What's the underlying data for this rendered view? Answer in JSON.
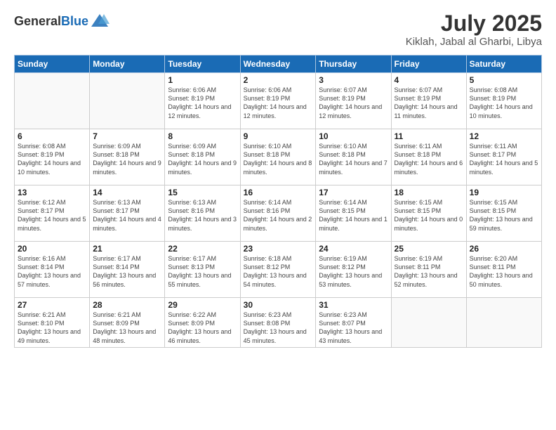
{
  "logo": {
    "general": "General",
    "blue": "Blue"
  },
  "header": {
    "month": "July 2025",
    "location": "Kiklah, Jabal al Gharbi, Libya"
  },
  "weekdays": [
    "Sunday",
    "Monday",
    "Tuesday",
    "Wednesday",
    "Thursday",
    "Friday",
    "Saturday"
  ],
  "weeks": [
    [
      {
        "day": "",
        "info": ""
      },
      {
        "day": "",
        "info": ""
      },
      {
        "day": "1",
        "info": "Sunrise: 6:06 AM\nSunset: 8:19 PM\nDaylight: 14 hours and 12 minutes."
      },
      {
        "day": "2",
        "info": "Sunrise: 6:06 AM\nSunset: 8:19 PM\nDaylight: 14 hours and 12 minutes."
      },
      {
        "day": "3",
        "info": "Sunrise: 6:07 AM\nSunset: 8:19 PM\nDaylight: 14 hours and 12 minutes."
      },
      {
        "day": "4",
        "info": "Sunrise: 6:07 AM\nSunset: 8:19 PM\nDaylight: 14 hours and 11 minutes."
      },
      {
        "day": "5",
        "info": "Sunrise: 6:08 AM\nSunset: 8:19 PM\nDaylight: 14 hours and 10 minutes."
      }
    ],
    [
      {
        "day": "6",
        "info": "Sunrise: 6:08 AM\nSunset: 8:19 PM\nDaylight: 14 hours and 10 minutes."
      },
      {
        "day": "7",
        "info": "Sunrise: 6:09 AM\nSunset: 8:18 PM\nDaylight: 14 hours and 9 minutes."
      },
      {
        "day": "8",
        "info": "Sunrise: 6:09 AM\nSunset: 8:18 PM\nDaylight: 14 hours and 9 minutes."
      },
      {
        "day": "9",
        "info": "Sunrise: 6:10 AM\nSunset: 8:18 PM\nDaylight: 14 hours and 8 minutes."
      },
      {
        "day": "10",
        "info": "Sunrise: 6:10 AM\nSunset: 8:18 PM\nDaylight: 14 hours and 7 minutes."
      },
      {
        "day": "11",
        "info": "Sunrise: 6:11 AM\nSunset: 8:18 PM\nDaylight: 14 hours and 6 minutes."
      },
      {
        "day": "12",
        "info": "Sunrise: 6:11 AM\nSunset: 8:17 PM\nDaylight: 14 hours and 5 minutes."
      }
    ],
    [
      {
        "day": "13",
        "info": "Sunrise: 6:12 AM\nSunset: 8:17 PM\nDaylight: 14 hours and 5 minutes."
      },
      {
        "day": "14",
        "info": "Sunrise: 6:13 AM\nSunset: 8:17 PM\nDaylight: 14 hours and 4 minutes."
      },
      {
        "day": "15",
        "info": "Sunrise: 6:13 AM\nSunset: 8:16 PM\nDaylight: 14 hours and 3 minutes."
      },
      {
        "day": "16",
        "info": "Sunrise: 6:14 AM\nSunset: 8:16 PM\nDaylight: 14 hours and 2 minutes."
      },
      {
        "day": "17",
        "info": "Sunrise: 6:14 AM\nSunset: 8:15 PM\nDaylight: 14 hours and 1 minute."
      },
      {
        "day": "18",
        "info": "Sunrise: 6:15 AM\nSunset: 8:15 PM\nDaylight: 14 hours and 0 minutes."
      },
      {
        "day": "19",
        "info": "Sunrise: 6:15 AM\nSunset: 8:15 PM\nDaylight: 13 hours and 59 minutes."
      }
    ],
    [
      {
        "day": "20",
        "info": "Sunrise: 6:16 AM\nSunset: 8:14 PM\nDaylight: 13 hours and 57 minutes."
      },
      {
        "day": "21",
        "info": "Sunrise: 6:17 AM\nSunset: 8:14 PM\nDaylight: 13 hours and 56 minutes."
      },
      {
        "day": "22",
        "info": "Sunrise: 6:17 AM\nSunset: 8:13 PM\nDaylight: 13 hours and 55 minutes."
      },
      {
        "day": "23",
        "info": "Sunrise: 6:18 AM\nSunset: 8:12 PM\nDaylight: 13 hours and 54 minutes."
      },
      {
        "day": "24",
        "info": "Sunrise: 6:19 AM\nSunset: 8:12 PM\nDaylight: 13 hours and 53 minutes."
      },
      {
        "day": "25",
        "info": "Sunrise: 6:19 AM\nSunset: 8:11 PM\nDaylight: 13 hours and 52 minutes."
      },
      {
        "day": "26",
        "info": "Sunrise: 6:20 AM\nSunset: 8:11 PM\nDaylight: 13 hours and 50 minutes."
      }
    ],
    [
      {
        "day": "27",
        "info": "Sunrise: 6:21 AM\nSunset: 8:10 PM\nDaylight: 13 hours and 49 minutes."
      },
      {
        "day": "28",
        "info": "Sunrise: 6:21 AM\nSunset: 8:09 PM\nDaylight: 13 hours and 48 minutes."
      },
      {
        "day": "29",
        "info": "Sunrise: 6:22 AM\nSunset: 8:09 PM\nDaylight: 13 hours and 46 minutes."
      },
      {
        "day": "30",
        "info": "Sunrise: 6:23 AM\nSunset: 8:08 PM\nDaylight: 13 hours and 45 minutes."
      },
      {
        "day": "31",
        "info": "Sunrise: 6:23 AM\nSunset: 8:07 PM\nDaylight: 13 hours and 43 minutes."
      },
      {
        "day": "",
        "info": ""
      },
      {
        "day": "",
        "info": ""
      }
    ]
  ]
}
